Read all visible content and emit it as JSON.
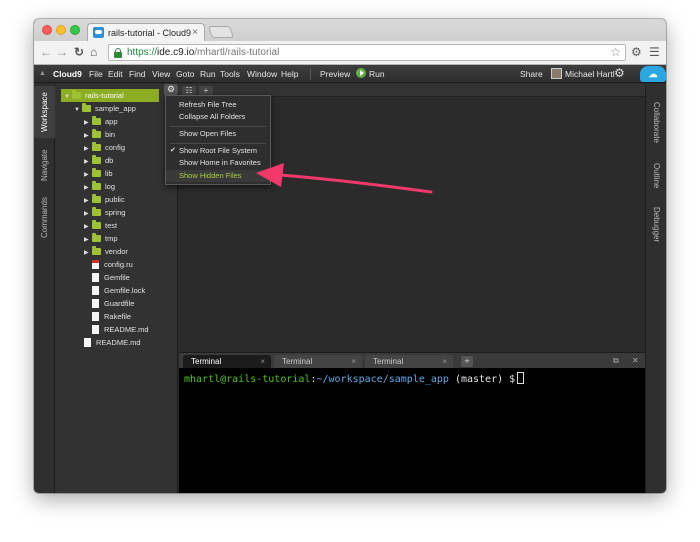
{
  "browser": {
    "tab_title": "rails-tutorial - Cloud9",
    "tab_close": "×",
    "url_scheme": "https://",
    "url_host": "ide.c9.io",
    "url_path": "/mhartl/rails-tutorial"
  },
  "menubar": {
    "brand": "Cloud9",
    "items": [
      "File",
      "Edit",
      "Find",
      "View",
      "Goto",
      "Run",
      "Tools",
      "Window",
      "Help"
    ],
    "preview": "Preview",
    "run": "Run",
    "share": "Share",
    "user": "Michael Hartl"
  },
  "left_panel_tabs": [
    "Workspace",
    "Navigate",
    "Commands"
  ],
  "right_panel_tabs": [
    "Collaborate",
    "Outline",
    "Debugger"
  ],
  "file_tree": [
    {
      "name": "rails-tutorial",
      "type": "folder",
      "expanded": true,
      "selected": true
    },
    {
      "name": "sample_app",
      "type": "folder",
      "expanded": true
    },
    {
      "name": "app",
      "type": "folder"
    },
    {
      "name": "bin",
      "type": "folder"
    },
    {
      "name": "config",
      "type": "folder"
    },
    {
      "name": "db",
      "type": "folder"
    },
    {
      "name": "lib",
      "type": "folder"
    },
    {
      "name": "log",
      "type": "folder"
    },
    {
      "name": "public",
      "type": "folder"
    },
    {
      "name": "spring",
      "type": "folder"
    },
    {
      "name": "test",
      "type": "folder"
    },
    {
      "name": "tmp",
      "type": "folder"
    },
    {
      "name": "vendor",
      "type": "folder"
    },
    {
      "name": "config.ru",
      "type": "ruby-file"
    },
    {
      "name": "Gemfile",
      "type": "file"
    },
    {
      "name": "Gemfile.lock",
      "type": "file"
    },
    {
      "name": "Guardfile",
      "type": "file"
    },
    {
      "name": "Rakefile",
      "type": "file"
    },
    {
      "name": "README.md",
      "type": "file"
    },
    {
      "name": "README.md",
      "type": "file"
    }
  ],
  "tree_menu": {
    "items": [
      {
        "label": "Refresh File Tree"
      },
      {
        "label": "Collapse All Folders"
      },
      {
        "label": "Show Open Files"
      },
      {
        "label": "Show Root File System",
        "checked": true
      },
      {
        "label": "Show Home in Favorites"
      },
      {
        "label": "Show Hidden Files",
        "highlighted": true
      }
    ],
    "highlight_color": "#a9cf3b"
  },
  "terminal": {
    "tabs": [
      "Terminal",
      "Terminal",
      "Terminal"
    ],
    "tab_close": "×",
    "prompt_user": "mhartl@rails-tutorial",
    "prompt_colon": ":",
    "prompt_path": "~/workspace/sample_app",
    "prompt_rest": " (master) $"
  },
  "annotation": {
    "color": "#f0386b"
  }
}
